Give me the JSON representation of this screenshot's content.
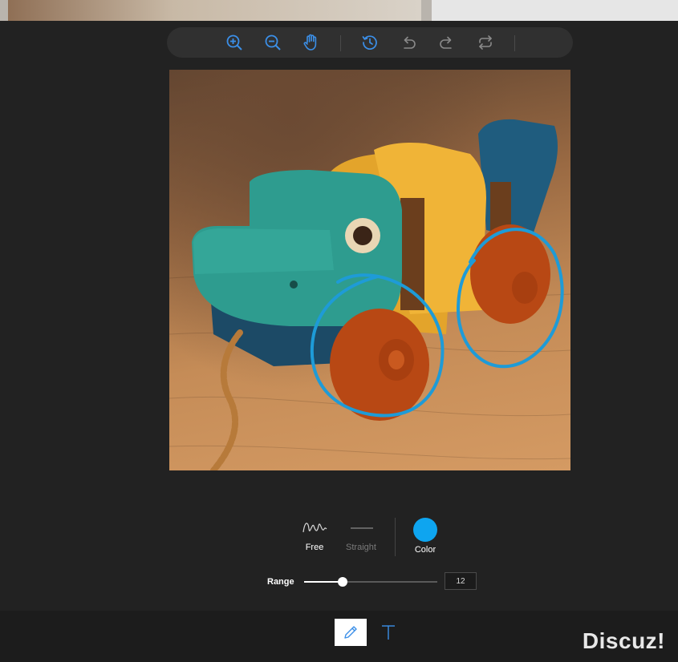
{
  "toolbar": {
    "buttons": [
      {
        "name": "zoom-in-icon"
      },
      {
        "name": "zoom-out-icon"
      },
      {
        "name": "hand-pan-icon"
      },
      {
        "name": "history-icon"
      },
      {
        "name": "undo-icon"
      },
      {
        "name": "redo-icon"
      },
      {
        "name": "reset-icon"
      }
    ]
  },
  "draw_tools": {
    "free_label": "Free",
    "straight_label": "Straight",
    "color_label": "Color",
    "selected_tool": "Free",
    "selected_color": "#0ea5f0"
  },
  "range": {
    "label": "Range",
    "value": "12",
    "fraction": 0.29
  },
  "bottom_modes": [
    {
      "name": "draw-mode",
      "active": true
    },
    {
      "name": "text-mode",
      "active": false
    }
  ],
  "watermark": "Discuz!",
  "colors": {
    "accent": "#3b8fe8",
    "annotation": "#1e9bd7",
    "muted": "#8a8a8a"
  }
}
